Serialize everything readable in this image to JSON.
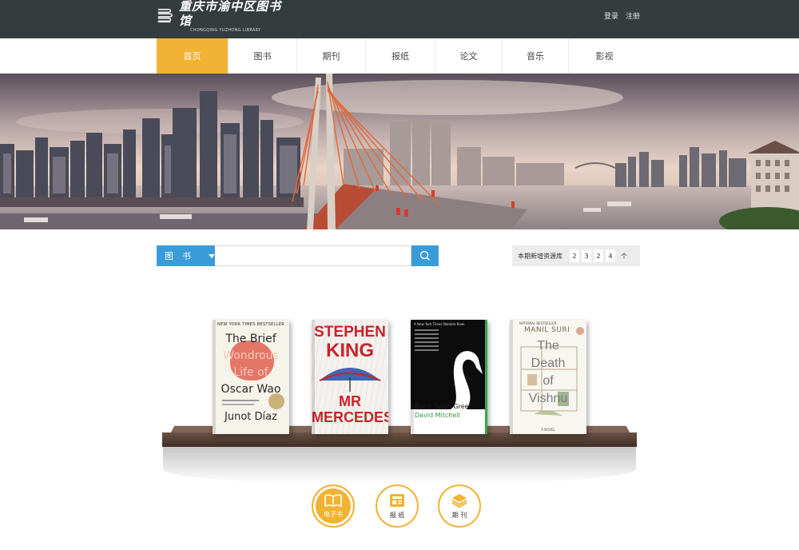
{
  "header": {
    "logo_title": "重庆市渝中区图书馆",
    "logo_subtitle": "CHONGQING YUZHONG LIBRARY",
    "login_label": "登录",
    "register_label": "注册"
  },
  "nav": {
    "items": [
      {
        "label": "首页",
        "active": true
      },
      {
        "label": "图书"
      },
      {
        "label": "期刊"
      },
      {
        "label": "报纸"
      },
      {
        "label": "论文"
      },
      {
        "label": "音乐"
      },
      {
        "label": "影视"
      }
    ]
  },
  "search": {
    "category": "图　书",
    "placeholder": "",
    "value": ""
  },
  "stats": {
    "label": "本期新增资源库",
    "digits": [
      "2",
      "3",
      "2",
      "4"
    ],
    "unit": "个"
  },
  "books": [
    {
      "badge": "NEW YORK TIMES BESTSELLER",
      "title_lines": [
        "The Brief",
        "Wondrous",
        "Life of",
        "Oscar Wao"
      ],
      "author": "Junot Díaz"
    },
    {
      "author_lines": [
        "STEPHEN",
        "KING"
      ],
      "title_lines": [
        "MR",
        "MERCEDES"
      ]
    },
    {
      "badge": "A New York Times Notable Book",
      "title": "Black Swan Green",
      "author": "David Mitchell"
    },
    {
      "badge": "NATIONAL BESTSELLER",
      "author": "MANIL SURI",
      "title_lines": [
        "The",
        "Death",
        "of",
        "Vishnu"
      ],
      "footer": "A NOVEL"
    }
  ],
  "quick_links": [
    {
      "label": "电子书",
      "icon": "open-book-icon",
      "active": true
    },
    {
      "label": "报 纸",
      "icon": "newspaper-icon"
    },
    {
      "label": "期 刊",
      "icon": "stacked-layers-icon"
    }
  ],
  "colors": {
    "header_bg": "#353c3d",
    "accent": "#f2b233",
    "search_blue": "#3a9bd9"
  }
}
